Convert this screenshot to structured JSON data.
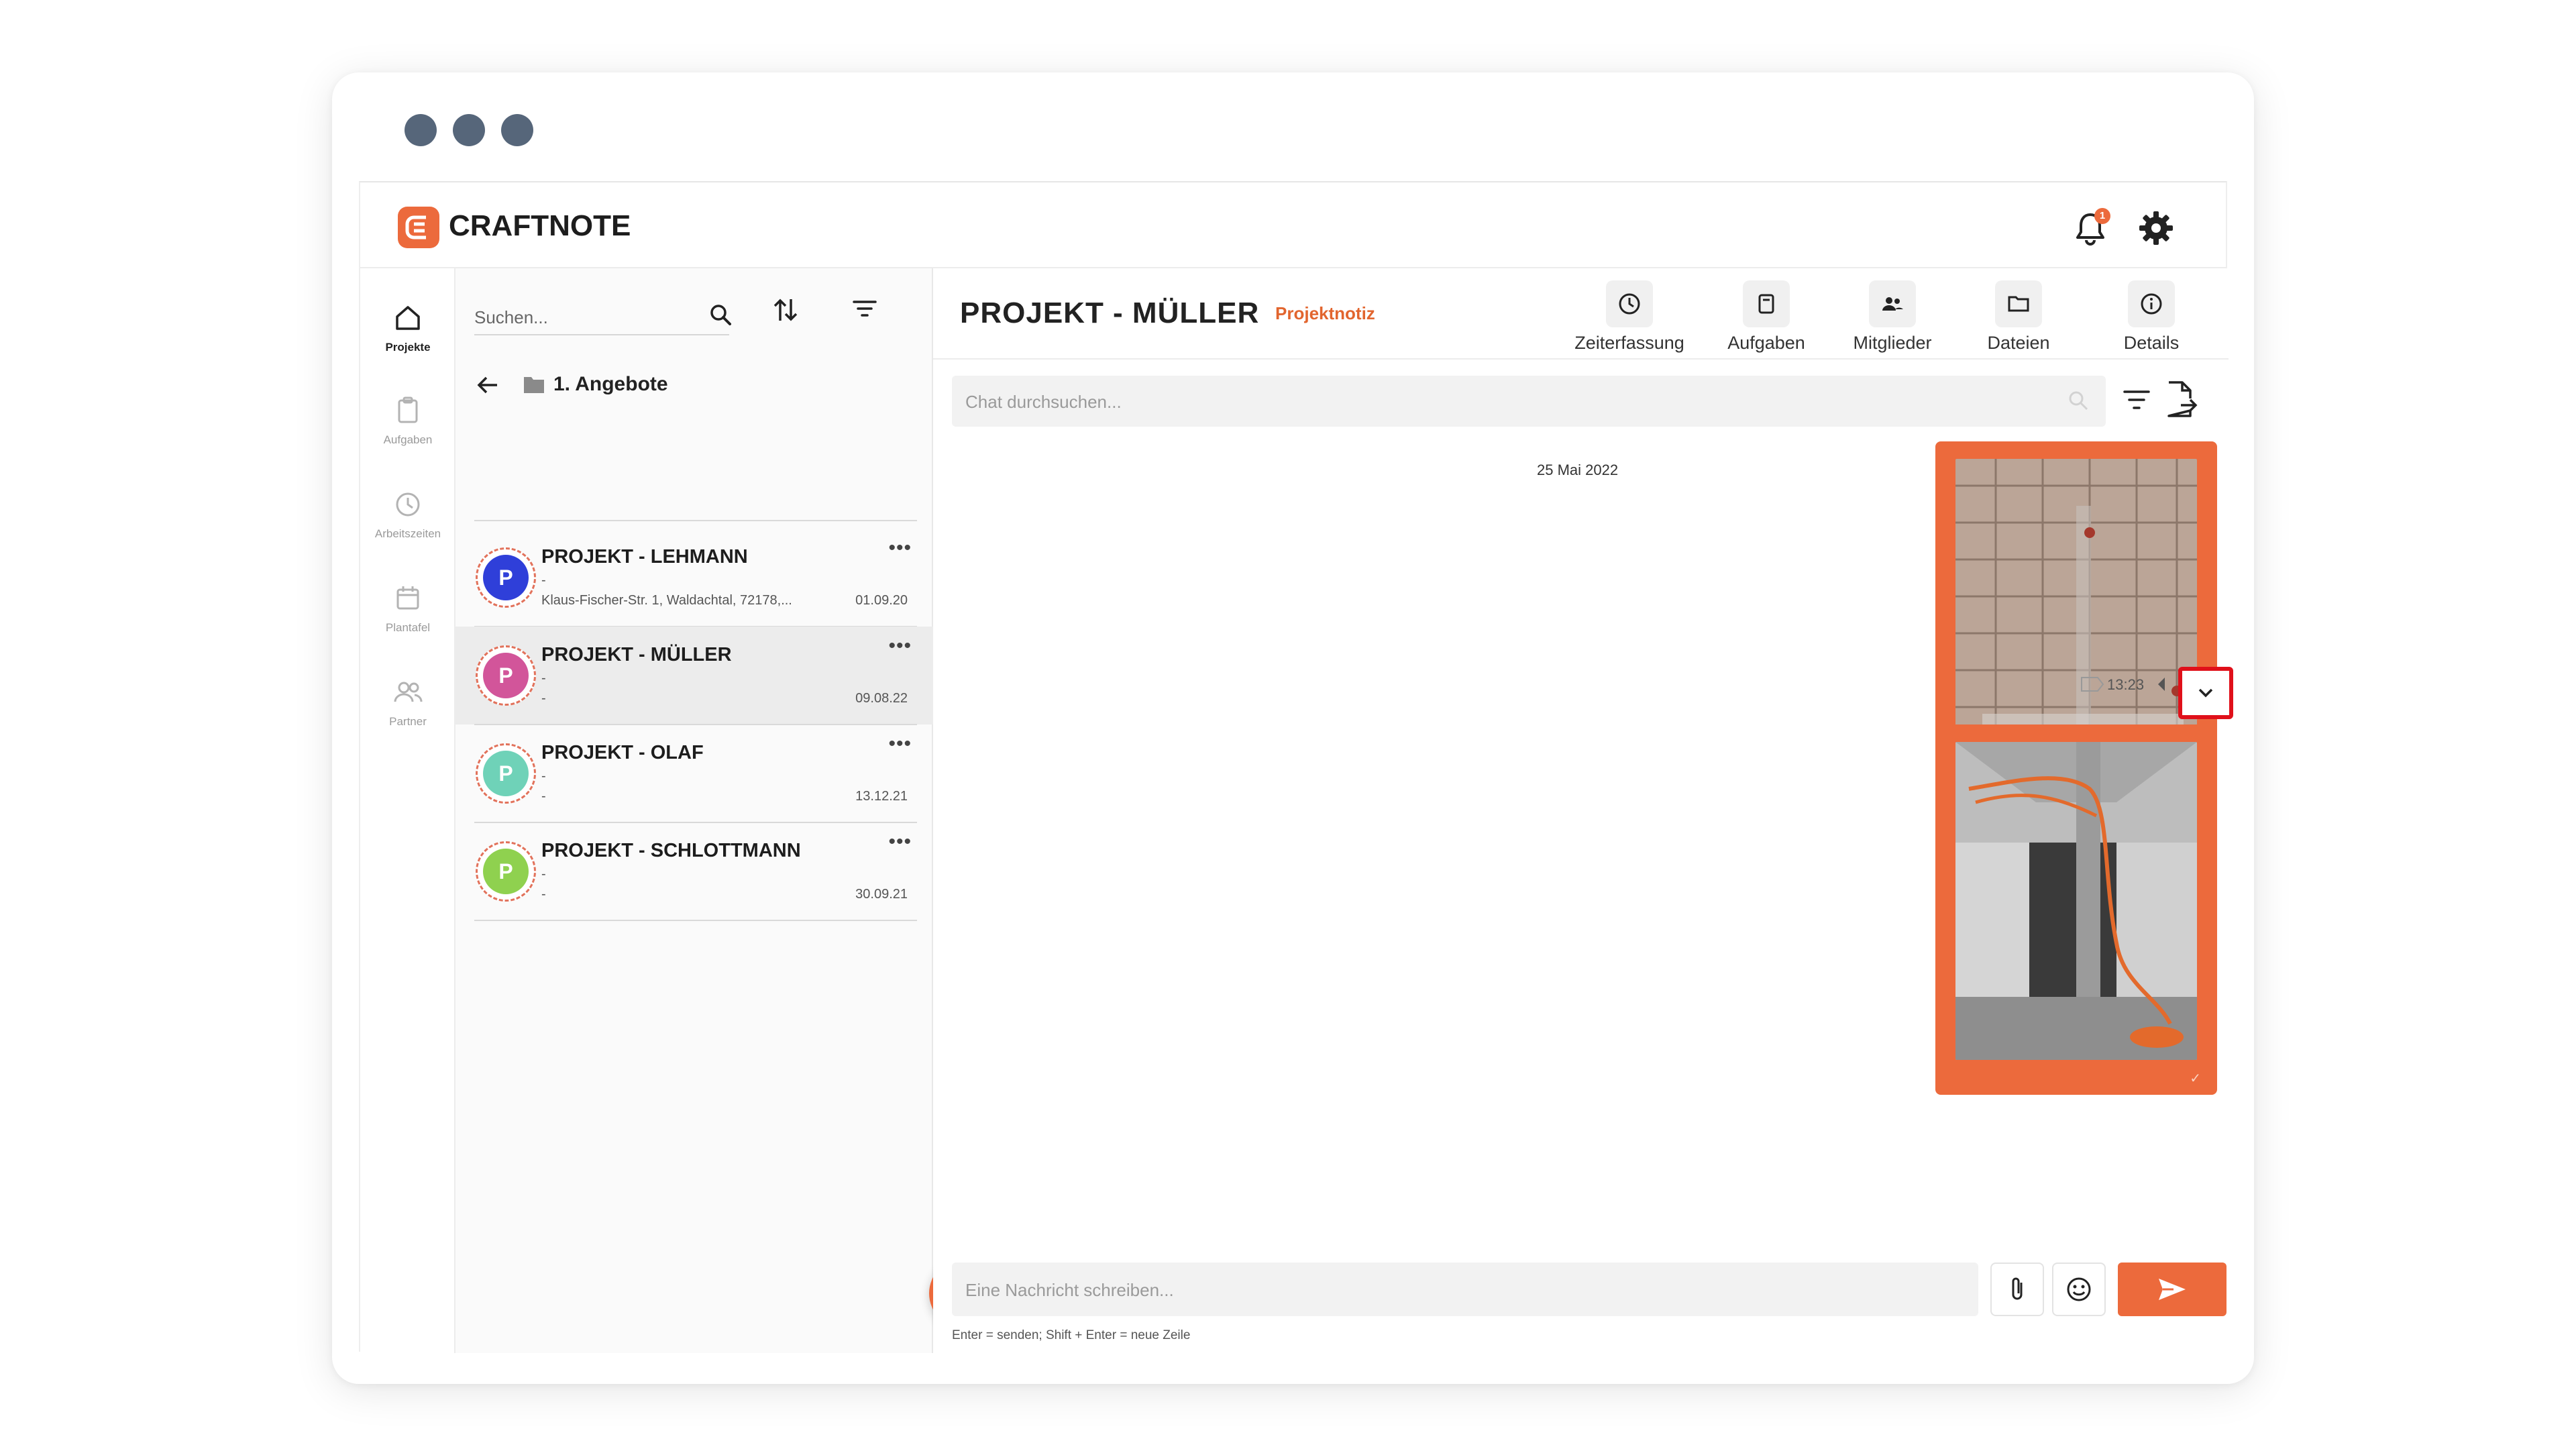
{
  "app": {
    "name": "CRAFTNOTE",
    "notification_count": "1",
    "accent": "#ec6a3c"
  },
  "nav": [
    {
      "label": "Projekte",
      "icon": "home-icon",
      "active": true
    },
    {
      "label": "Aufgaben",
      "icon": "clipboard-icon"
    },
    {
      "label": "Arbeitszeiten",
      "icon": "clock-icon"
    },
    {
      "label": "Plantafel",
      "icon": "calendar-icon"
    },
    {
      "label": "Partner",
      "icon": "people-icon"
    }
  ],
  "list": {
    "search_placeholder": "Suchen...",
    "folder": "1. Angebote",
    "projects": [
      {
        "name": "PROJEKT - LEHMANN",
        "line1": "-",
        "line2": "Klaus-Fischer-Str. 1, Waldachtal, 72178,...",
        "date": "01.09.20",
        "letter": "P",
        "color": "#2f3fd9"
      },
      {
        "name": "PROJEKT - MÜLLER",
        "line1": "-",
        "line2": "-",
        "date": "09.08.22",
        "letter": "P",
        "color": "#d2559a"
      },
      {
        "name": "PROJEKT - OLAF",
        "line1": "-",
        "line2": "-",
        "date": "13.12.21",
        "letter": "P",
        "color": "#6fd2b8"
      },
      {
        "name": "PROJEKT - SCHLOTTMANN",
        "line1": "-",
        "line2": "-",
        "date": "30.09.21",
        "letter": "P",
        "color": "#8fd14f"
      }
    ],
    "add_label": "+"
  },
  "chat": {
    "title": "PROJEKT - MÜLLER",
    "subtitle": "Projektnotiz",
    "actions": [
      "Zeiterfassung",
      "Aufgaben",
      "Mitglieder",
      "Dateien",
      "Details"
    ],
    "search_placeholder": "Chat durchsuchen...",
    "date_separator": "25 Mai 2022",
    "message_time": "13:23",
    "composer_placeholder": "Eine Nachricht schreiben...",
    "hint": "Enter = senden; Shift + Enter = neue Zeile",
    "read_mark": "✓"
  }
}
